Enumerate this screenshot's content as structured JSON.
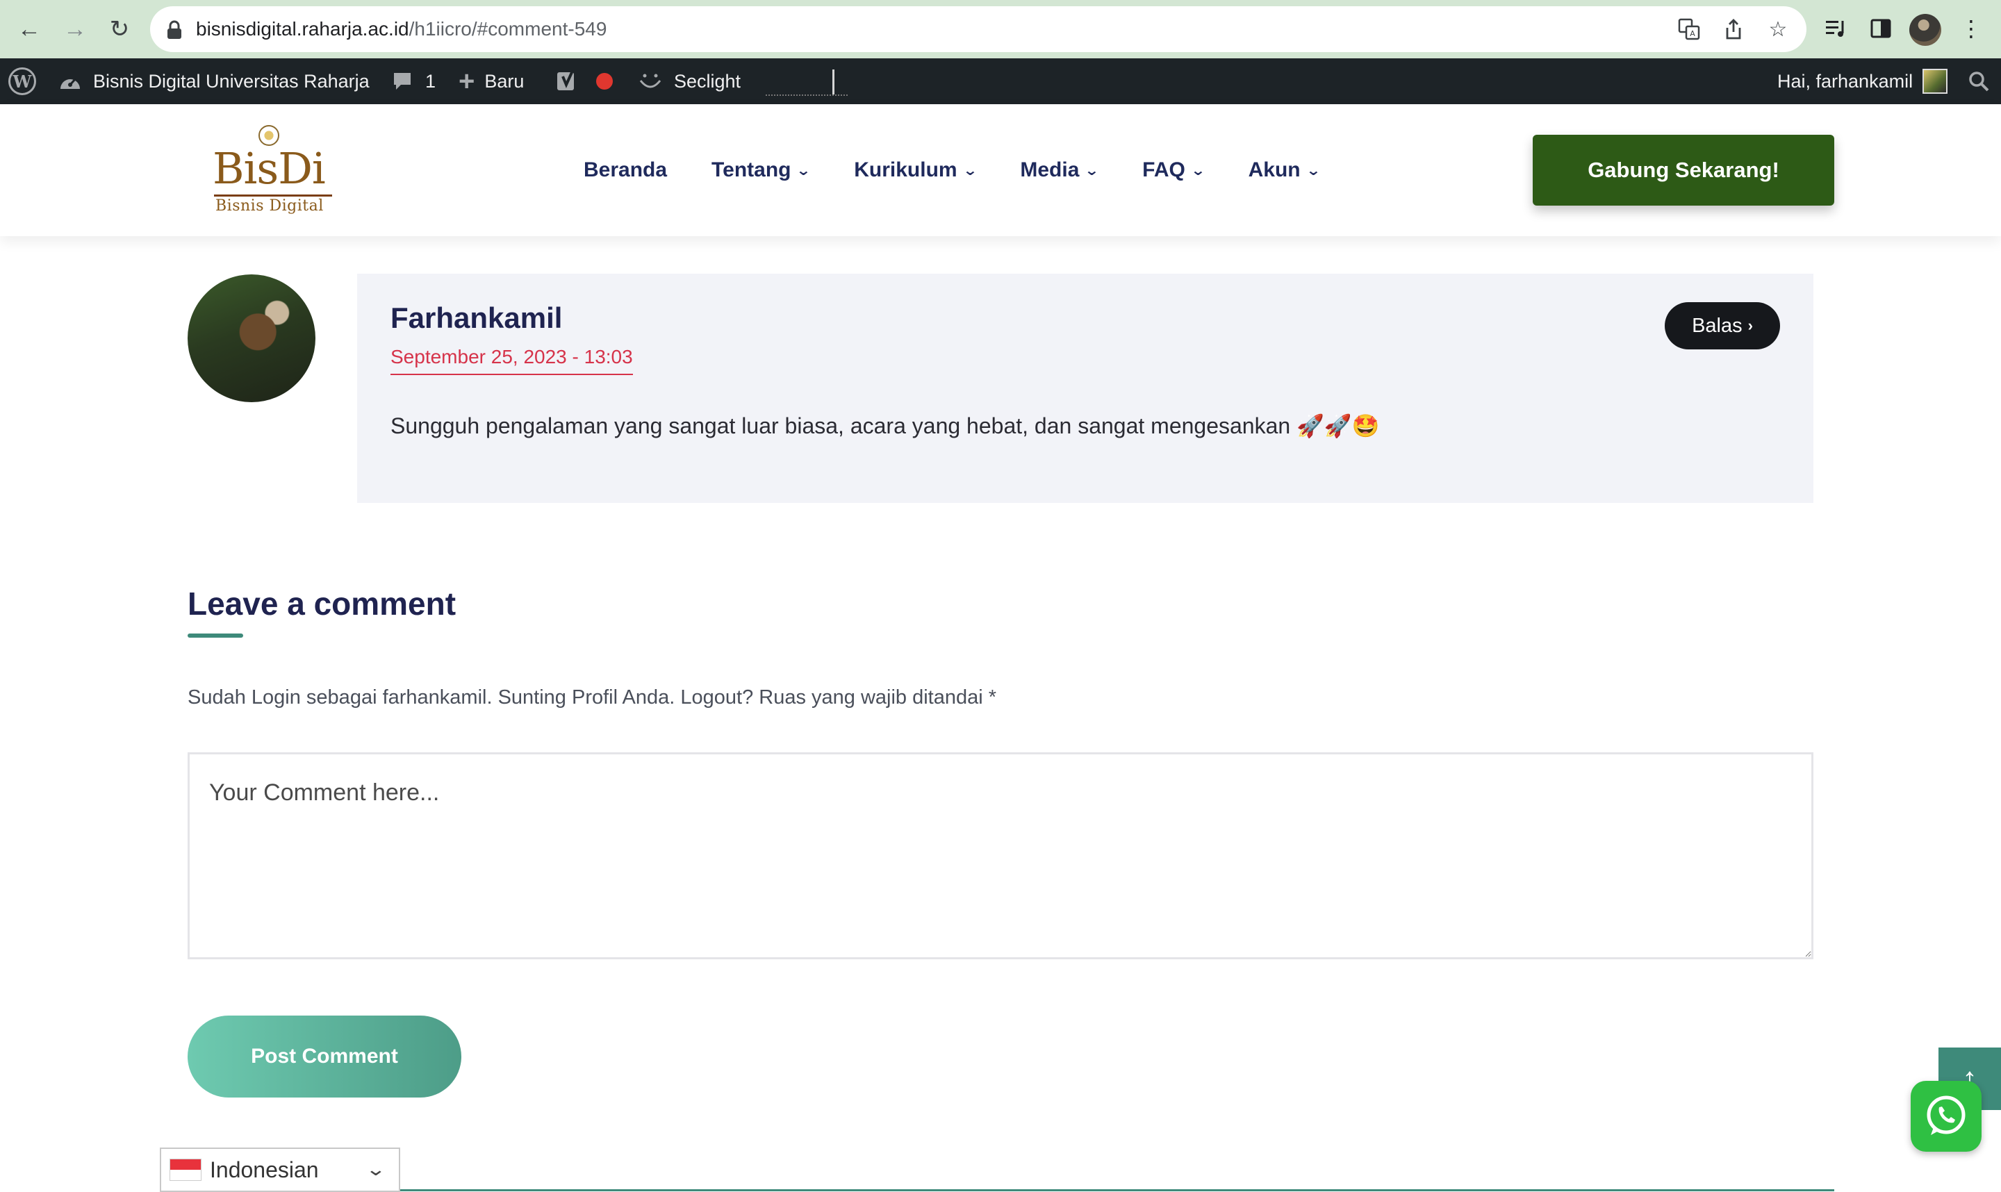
{
  "browser": {
    "url_host": "bisnisdigital.raharja.ac.id",
    "url_path": "/h1iicro/#comment-549"
  },
  "adminbar": {
    "site_name": "Bisnis Digital Universitas Raharja",
    "comments_count": "1",
    "new_label": "Baru",
    "seclight_label": "Seclight",
    "greeting": "Hai, farhankamil"
  },
  "header": {
    "logo_text": "BisDi",
    "logo_subtitle": "Bisnis Digital",
    "nav": [
      {
        "label": "Beranda",
        "has_dropdown": false
      },
      {
        "label": "Tentang",
        "has_dropdown": true
      },
      {
        "label": "Kurikulum",
        "has_dropdown": true
      },
      {
        "label": "Media",
        "has_dropdown": true
      },
      {
        "label": "FAQ",
        "has_dropdown": true
      },
      {
        "label": "Akun",
        "has_dropdown": true
      }
    ],
    "cta_label": "Gabung Sekarang!"
  },
  "comment": {
    "author": "Farhankamil",
    "date": "September 25, 2023 - 13:03",
    "text": "Sungguh pengalaman yang sangat luar biasa, acara yang hebat, dan sangat mengesankan 🚀🚀🤩",
    "reply_label": "Balas"
  },
  "leave_comment": {
    "title": "Leave a comment",
    "note": "Sudah Login sebagai farhankamil. Sunting Profil Anda. Logout? Ruas yang wajib ditandai *",
    "placeholder": "Your Comment here...",
    "submit_label": "Post Comment"
  },
  "language": {
    "selected": "Indonesian"
  },
  "colors": {
    "brand_navy": "#1f2350",
    "cta_green": "#2d5a16",
    "accent_teal": "#3e8a7a",
    "date_red": "#d6334a"
  }
}
